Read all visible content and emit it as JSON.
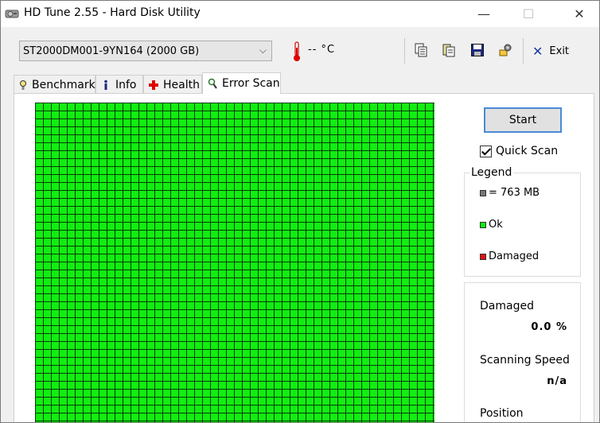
{
  "window": {
    "title": "HD Tune 2.55 - Hard Disk Utility",
    "controls": {
      "minimize": "—",
      "maximize": "☐",
      "close": "✕"
    }
  },
  "toolbar": {
    "drive": "ST2000DM001-9YN164 (2000 GB)",
    "temperature": "-- °C",
    "exit_label": "Exit",
    "buttons": [
      "copy-icon",
      "copy-info-icon",
      "save-icon",
      "options-icon"
    ]
  },
  "tabs": [
    {
      "label": "Benchmark",
      "icon": "benchmark-icon",
      "active": false
    },
    {
      "label": "Info",
      "icon": "info-icon",
      "active": false
    },
    {
      "label": "Health",
      "icon": "health-icon",
      "active": false
    },
    {
      "label": "Error Scan",
      "icon": "magnifier-icon",
      "active": true
    }
  ],
  "scan": {
    "start_label": "Start",
    "quick_scan_label": "Quick Scan",
    "quick_scan_checked": true,
    "legend": {
      "title": "Legend",
      "block_size": "= 763 MB",
      "ok": "Ok",
      "damaged": "Damaged"
    },
    "stats": {
      "damaged_label": "Damaged",
      "damaged_value": "0.0 %",
      "speed_label": "Scanning Speed",
      "speed_value": "n/a",
      "position_label": "Position"
    },
    "grid": {
      "status": "ok"
    }
  },
  "colors": {
    "ok_block": "#11ee11",
    "damaged_block": "#dd1111",
    "block_size_swatch": "#777777",
    "grid_line": "#0a3a0a",
    "accent": "#4a8ad6"
  }
}
